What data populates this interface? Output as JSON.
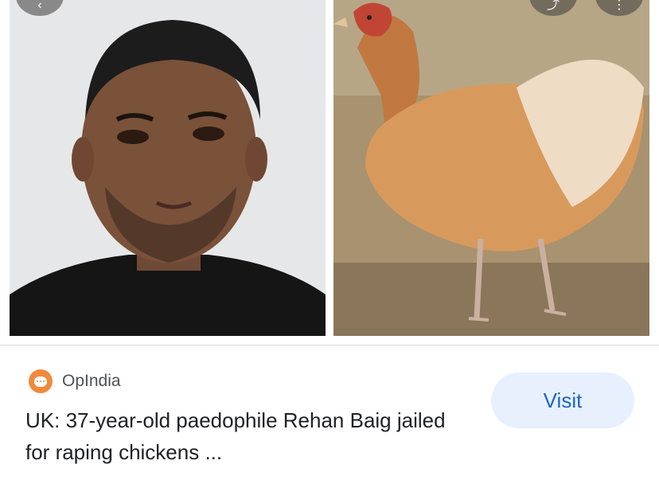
{
  "result": {
    "source_name": "OpIndia",
    "source_icon": "opindia-logo-icon",
    "title": "UK: 37-year-old paedophile Rehan Baig jailed for raping chickens ...",
    "visit_label": "Visit"
  },
  "top_controls": {
    "back_icon": "back-arrow-icon",
    "share_icon": "share-icon",
    "more_icon": "more-options-icon"
  },
  "colors": {
    "visit_bg": "#e8f0fe",
    "visit_text": "#1a66c2",
    "source_icon": "#f08a3c"
  }
}
